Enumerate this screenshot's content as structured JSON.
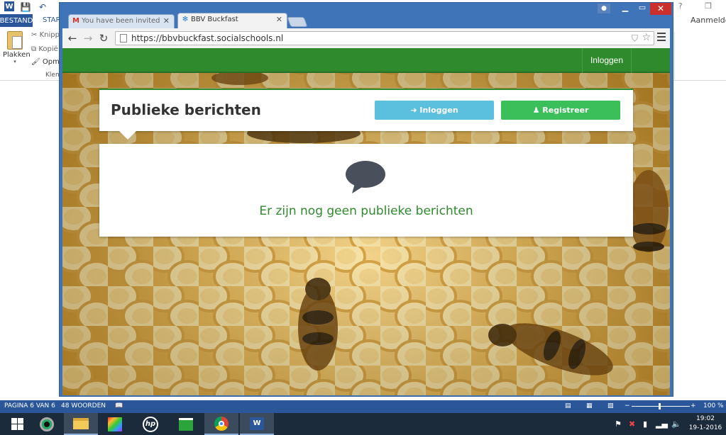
{
  "word": {
    "tabs": {
      "file": "BESTAND",
      "start": "STAR"
    },
    "signin": "Aanmelden",
    "ribbon": {
      "paste": "Plakken",
      "cut": "Knipp",
      "copy": "Kopië",
      "format": "Opma",
      "group": "Klem"
    },
    "status": {
      "page": "PAGINA 6 VAN 6",
      "words": "48 WOORDEN",
      "zoom": "100 %"
    },
    "zoom_level": 1.0
  },
  "taskbar": {
    "apps": [
      "windows-start",
      "camera-app",
      "file-explorer",
      "photo-app",
      "hp-app",
      "store-app",
      "chrome-app",
      "word-app"
    ],
    "clock_time": "19:02",
    "clock_date": "19-1-2016"
  },
  "browser": {
    "tabs": [
      {
        "title": "You have been invited to B",
        "favicon": "gmail-icon"
      },
      {
        "title": "BBV Buckfast",
        "favicon": "bbv-icon"
      }
    ],
    "url": "https://bbvbuckfast.socialschools.nl"
  },
  "site": {
    "nav_login": "Inloggen",
    "page_title": "Publieke berichten",
    "login_button": "Inloggen",
    "register_button": "Registreer",
    "empty_message": "Er zijn nog geen publieke berichten"
  },
  "colors": {
    "brand_green": "#2f8a2d",
    "login_blue": "#5bc0de",
    "register_green": "#3bbf5a",
    "word_blue": "#2b579a"
  }
}
